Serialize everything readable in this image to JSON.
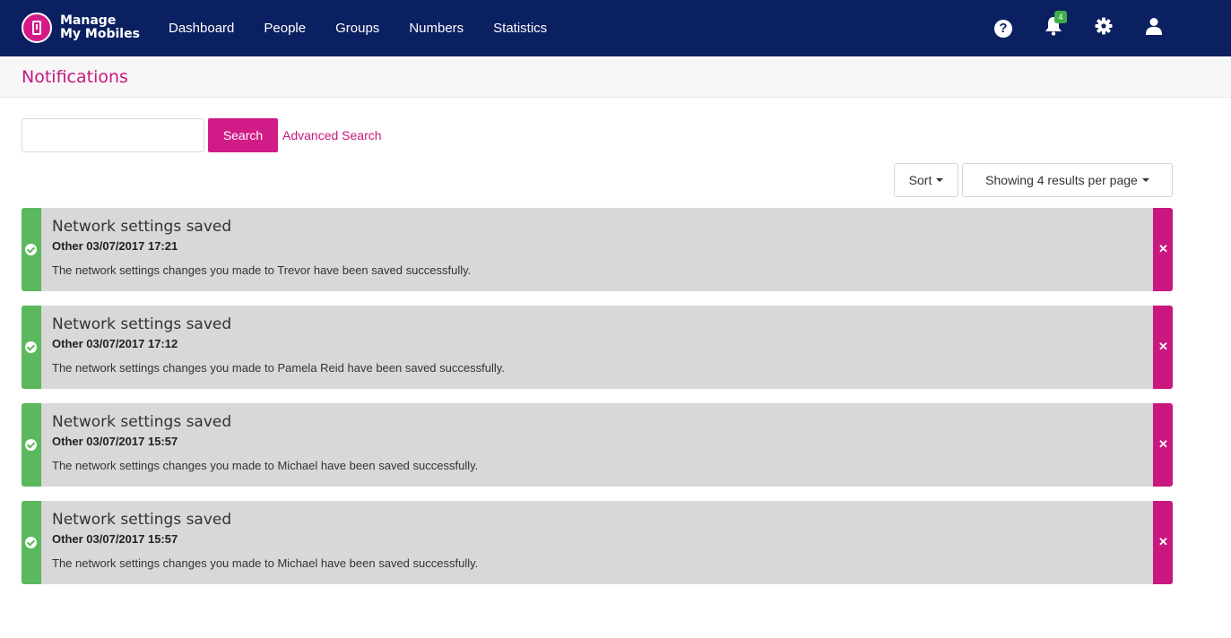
{
  "brand": {
    "line1": "Manage",
    "line2": "My Mobiles"
  },
  "nav": {
    "links": [
      "Dashboard",
      "People",
      "Groups",
      "Numbers",
      "Statistics"
    ],
    "icons": {
      "help": "help-icon",
      "bell": "bell-icon",
      "bell_badge": "4",
      "settings": "gear-icon",
      "user": "user-icon"
    },
    "colors": {
      "navbar": "#0b2060",
      "accent": "#d11b86",
      "badge": "#3fae49"
    }
  },
  "page": {
    "title": "Notifications"
  },
  "search": {
    "value": "",
    "placeholder": "",
    "button_label": "Search",
    "advanced_label": "Advanced Search"
  },
  "controls": {
    "sort_label": "Sort",
    "per_page_label": "Showing 4 results per page"
  },
  "notifications": [
    {
      "title": "Network settings saved",
      "meta": "Other 03/07/2017 17:21",
      "body": "The network settings changes you made to Trevor have been saved successfully."
    },
    {
      "title": "Network settings saved",
      "meta": "Other 03/07/2017 17:12",
      "body": "The network settings changes you made to Pamela Reid have been saved successfully."
    },
    {
      "title": "Network settings saved",
      "meta": "Other 03/07/2017 15:57",
      "body": "The network settings changes you made to Michael have been saved successfully."
    },
    {
      "title": "Network settings saved",
      "meta": "Other 03/07/2017 15:57",
      "body": "The network settings changes you made to Michael have been saved successfully."
    }
  ],
  "status_colors": {
    "success": "#5cb85c",
    "dismiss": "#c8177f"
  }
}
